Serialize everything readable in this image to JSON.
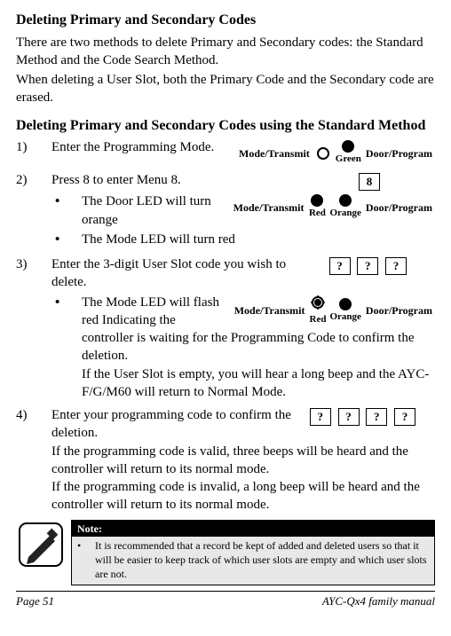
{
  "title": "Deleting Primary and Secondary Codes",
  "intro1": "There are two methods to delete Primary and Secondary codes: the Standard Method and the Code Search Method.",
  "intro2": "When deleting a User Slot, both the Primary Code and the Secondary code are erased.",
  "subtitle": "Deleting Primary and Secondary Codes using the Standard Method",
  "steps": {
    "s1_num": "1)",
    "s1": "Enter the Programming Mode.",
    "s2_num": "2)",
    "s2": "Press 8 to enter Menu 8.",
    "s2_b1": "The Door LED will turn orange",
    "s2_b2": "The Mode LED will turn red",
    "s3_num": "3)",
    "s3": "Enter the 3-digit User Slot code you wish to delete.",
    "s3_b1": "The Mode LED will flash red Indicating the controller is waiting for the Programming Code to confirm the deletion.",
    "s3_b1b": "If the User Slot is empty, you will hear a long beep and the AYC- F/G/M60 will return to Normal Mode.",
    "s4_num": "4)",
    "s4": "Enter your programming code to confirm the deletion.",
    "s4a": "If the programming code is valid, three beeps will be heard and the controller will return to its normal mode.",
    "s4b": "If the programming code is invalid, a long beep will be heard and the controller will return to its normal mode."
  },
  "diag": {
    "mode": "Mode/Transmit",
    "door": "Door/Program",
    "green": "Green",
    "red": "Red",
    "orange": "Orange",
    "key8": "8",
    "q": "?"
  },
  "note": {
    "title": "Note:",
    "text": "It is recommended that a record be kept of added and deleted users so that it will be easier to keep track of which user slots are empty and which user slots are not."
  },
  "footer": {
    "page": "Page 51",
    "manual": "AYC-Qx4 family manual"
  },
  "bullet": "•"
}
